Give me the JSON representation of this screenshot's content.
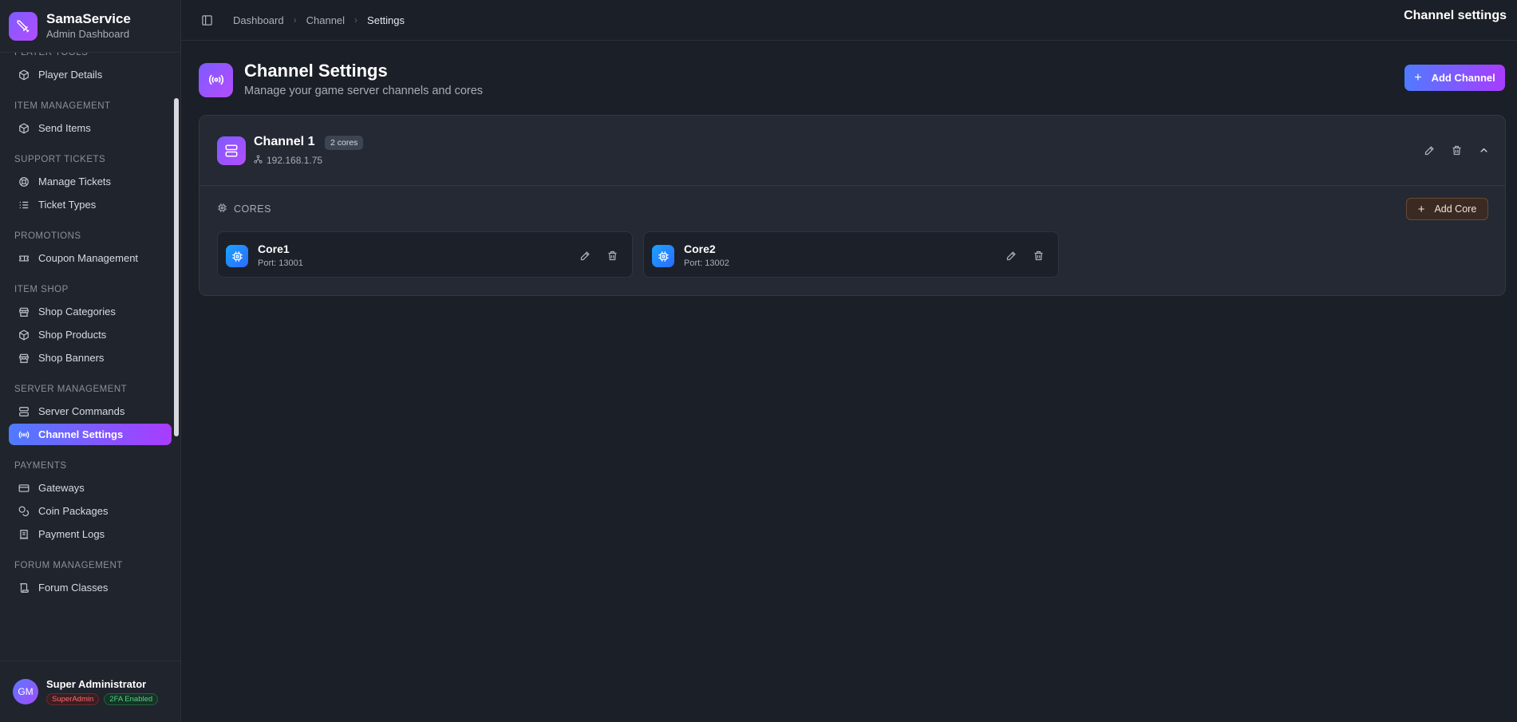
{
  "brand": {
    "title": "SamaService",
    "subtitle": "Admin Dashboard"
  },
  "sidebar": {
    "sections": [
      {
        "title": "PLAYER TOOLS",
        "items": [
          {
            "label": "Player Details",
            "icon": "cube-icon"
          }
        ]
      },
      {
        "title": "ITEM MANAGEMENT",
        "items": [
          {
            "label": "Send Items",
            "icon": "cube-icon"
          }
        ]
      },
      {
        "title": "SUPPORT TICKETS",
        "items": [
          {
            "label": "Manage Tickets",
            "icon": "lifebuoy-icon"
          },
          {
            "label": "Ticket Types",
            "icon": "list-icon"
          }
        ]
      },
      {
        "title": "PROMOTIONS",
        "items": [
          {
            "label": "Coupon Management",
            "icon": "ticket-icon"
          }
        ]
      },
      {
        "title": "ITEM SHOP",
        "items": [
          {
            "label": "Shop Categories",
            "icon": "store-icon"
          },
          {
            "label": "Shop Products",
            "icon": "cube-icon"
          },
          {
            "label": "Shop Banners",
            "icon": "store-icon"
          }
        ]
      },
      {
        "title": "SERVER MANAGEMENT",
        "items": [
          {
            "label": "Server Commands",
            "icon": "server-icon"
          },
          {
            "label": "Channel Settings",
            "icon": "broadcast-icon",
            "active": true
          }
        ]
      },
      {
        "title": "PAYMENTS",
        "items": [
          {
            "label": "Gateways",
            "icon": "card-icon"
          },
          {
            "label": "Coin Packages",
            "icon": "coins-icon"
          },
          {
            "label": "Payment Logs",
            "icon": "receipt-icon"
          }
        ]
      },
      {
        "title": "FORUM MANAGEMENT",
        "items": [
          {
            "label": "Forum Classes",
            "icon": "scroll-icon"
          }
        ]
      }
    ]
  },
  "user": {
    "initials": "GM",
    "name": "Super Administrator",
    "role_badge": "SuperAdmin",
    "security_badge": "2FA Enabled"
  },
  "topbar": {
    "breadcrumbs": [
      "Dashboard",
      "Channel",
      "Settings"
    ],
    "title": "Channel settings"
  },
  "page": {
    "title": "Channel Settings",
    "subtitle": "Manage your game server channels and cores",
    "add_channel_label": "Add Channel"
  },
  "channel": {
    "name": "Channel 1",
    "cores_badge": "2 cores",
    "ip": "192.168.1.75",
    "cores_label": "CORES",
    "add_core_label": "Add Core",
    "cores": [
      {
        "name": "Core1",
        "port": "Port: 13001"
      },
      {
        "name": "Core2",
        "port": "Port: 13002"
      }
    ]
  },
  "colors": {
    "accent_start": "#4f7bff",
    "accent_end": "#a93cff",
    "background": "#1b1f27",
    "core_icon": "#1aa3ff"
  }
}
